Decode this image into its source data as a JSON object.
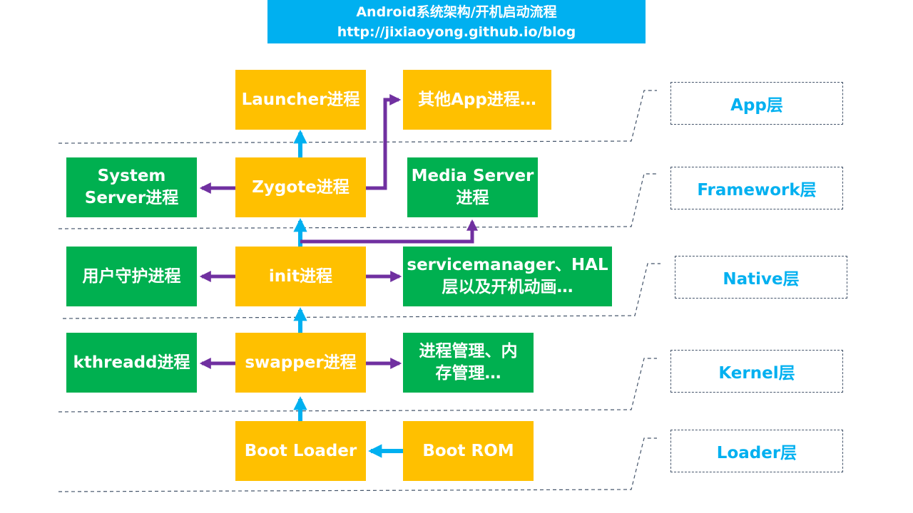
{
  "header": {
    "title": "Android系统架构/开机启动流程",
    "url": "http://jixiaoyong.github.io/blog"
  },
  "layers": {
    "app": "App层",
    "framework": "Framework层",
    "native": "Native层",
    "kernel": "Kernel层",
    "loader": "Loader层"
  },
  "nodes": {
    "launcher": "Launcher进程",
    "other_apps": "其他App进程…",
    "system_server_l1": "System",
    "system_server_l2": "Server进程",
    "zygote": "Zygote进程",
    "media_server_l1": "Media Server",
    "media_server_l2": "进程",
    "daemon": "用户守护进程",
    "init": "init进程",
    "servicemanager_l1": "servicemanager、HAL",
    "servicemanager_l2": "层以及开机动画…",
    "kthreadd": "kthreadd进程",
    "swapper": "swapper进程",
    "process_mgmt_l1": "进程管理、内",
    "process_mgmt_l2": "存管理…",
    "boot_loader": "Boot Loader",
    "boot_rom": "Boot ROM"
  },
  "colors": {
    "title_bg": "#00b0f0",
    "orange_node": "#ffc000",
    "green_node": "#00b050",
    "arrow_blue": "#00b0f0",
    "arrow_purple": "#7030a0",
    "layer_text": "#00b0f0",
    "separator": "#44546a"
  }
}
